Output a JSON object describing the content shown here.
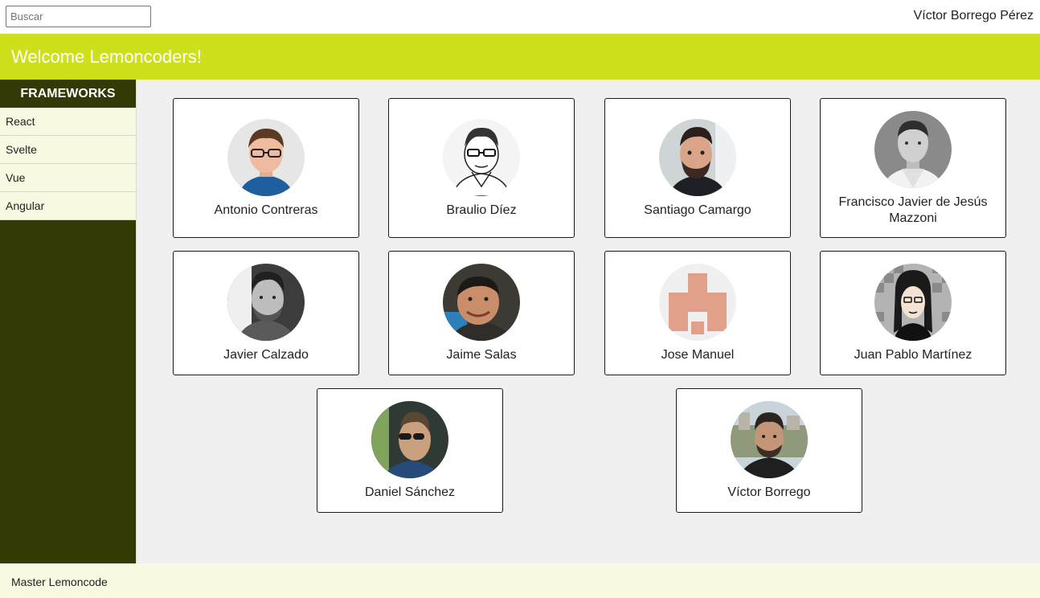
{
  "topbar": {
    "search_placeholder": "Buscar",
    "search_value": "",
    "user_name": "Víctor Borrego Pérez"
  },
  "banner": {
    "title": "Welcome Lemoncoders!"
  },
  "sidebar": {
    "header": "FRAMEWORKS",
    "items": [
      {
        "label": "React"
      },
      {
        "label": "Svelte"
      },
      {
        "label": "Vue"
      },
      {
        "label": "Angular"
      }
    ]
  },
  "members": [
    {
      "name": "Antonio Contreras",
      "avatar": "photo-glasses"
    },
    {
      "name": "Braulio Díez",
      "avatar": "sketch-glasses"
    },
    {
      "name": "Santiago Camargo",
      "avatar": "photo-beard"
    },
    {
      "name": "Francisco Javier de Jesús Mazzoni",
      "avatar": "photo-bw"
    },
    {
      "name": "Javier Calzado",
      "avatar": "photo-bw-beard"
    },
    {
      "name": "Jaime Salas",
      "avatar": "photo-smile"
    },
    {
      "name": "Jose Manuel",
      "avatar": "identicon"
    },
    {
      "name": "Juan Pablo Martínez",
      "avatar": "cartoon"
    },
    {
      "name": "Daniel Sánchez",
      "avatar": "photo-sunglasses"
    },
    {
      "name": "Víctor Borrego",
      "avatar": "photo-outdoor"
    }
  ],
  "footer": {
    "text": "Master Lemoncode"
  },
  "colors": {
    "accent": "#cde01b",
    "sidebar_bg": "#343a06",
    "item_bg": "#f7f9e1",
    "main_bg": "#f0f0f0"
  }
}
